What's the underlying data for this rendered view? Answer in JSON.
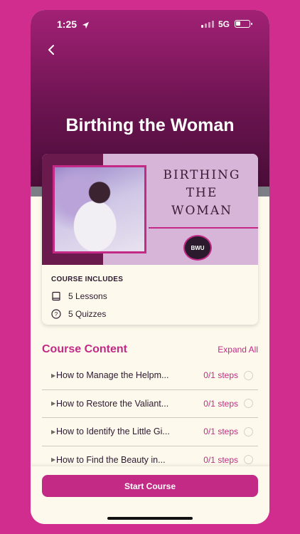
{
  "colors": {
    "accent": "#c22a86",
    "background": "#d12d8f",
    "hero": "#6b1450"
  },
  "status_bar": {
    "time": "1:25",
    "network": "5G",
    "location_icon": "location-arrow-icon",
    "battery_icon": "battery-icon",
    "signal_icon": "signal-icon"
  },
  "header": {
    "back_icon": "chevron-left-icon",
    "title": "Birthing the Woman"
  },
  "cover": {
    "line1": "BIRTHING",
    "line2": "THE",
    "line3": "WOMAN",
    "seal_text": "BWU"
  },
  "includes": {
    "heading": "COURSE INCLUDES",
    "items": [
      {
        "icon": "book-icon",
        "label": "5 Lessons"
      },
      {
        "icon": "question-circle-icon",
        "label": "5 Quizzes"
      }
    ]
  },
  "course_content": {
    "heading": "Course Content",
    "expand_label": "Expand All",
    "lessons": [
      {
        "title": "How to Manage the Helpm...",
        "steps": "0/1 steps"
      },
      {
        "title": "How to Restore the Valiant...",
        "steps": "0/1 steps"
      },
      {
        "title": "How to Identify the Little Gi...",
        "steps": "0/1 steps"
      },
      {
        "title": "How to Find the Beauty in...",
        "steps": "0/1 steps"
      }
    ]
  },
  "footer": {
    "button_label": "Start Course"
  }
}
